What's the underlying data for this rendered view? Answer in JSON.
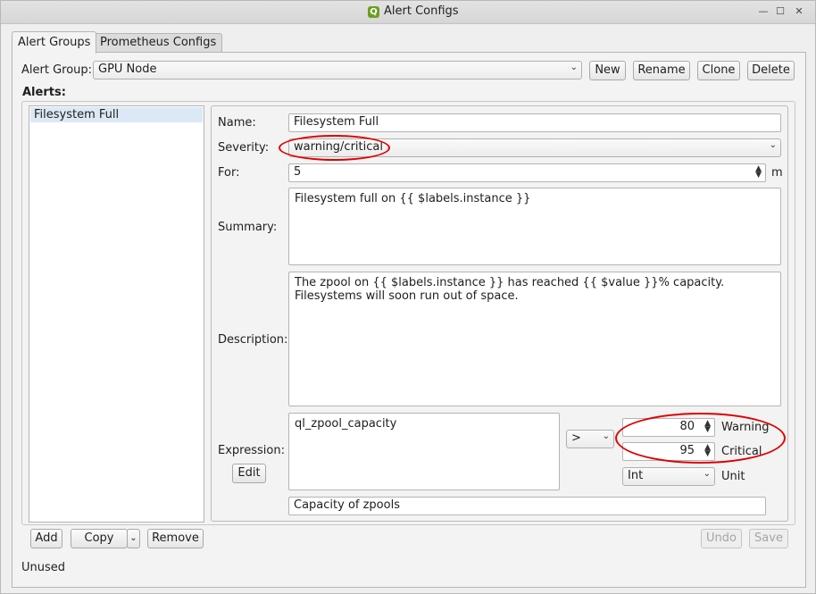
{
  "window": {
    "title": "Alert Configs",
    "app_icon": "Q"
  },
  "tabs": [
    {
      "label": "Alert Groups",
      "active": true
    },
    {
      "label": "Prometheus Configs",
      "active": false
    }
  ],
  "alert_group": {
    "label": "Alert Group:",
    "selected": "GPU Node",
    "buttons": {
      "new": "New",
      "rename": "Rename",
      "clone": "Clone",
      "delete": "Delete"
    }
  },
  "alerts_label": "Alerts:",
  "alerts_list": [
    "Filesystem Full"
  ],
  "list_buttons": {
    "add": "Add",
    "copy": "Copy",
    "remove": "Remove"
  },
  "form": {
    "name_label": "Name:",
    "name_value": "Filesystem Full",
    "severity_label": "Severity:",
    "severity_value": "warning/critical",
    "for_label": "For:",
    "for_value": "5",
    "for_unit": "m",
    "summary_label": "Summary:",
    "summary_value": "Filesystem full on {{ $labels.instance }}",
    "description_label": "Description:",
    "description_value": "The zpool on {{ $labels.instance }} has reached {{ $value }}% capacity. Filesystems will soon run out of space.",
    "expression_label": "Expression:",
    "expression_value": "ql_zpool_capacity",
    "edit_button": "Edit",
    "operator_value": ">",
    "warning_value": "80",
    "warning_label": "Warning",
    "critical_value": "95",
    "critical_label": "Critical",
    "unit_value": "Int",
    "unit_label": "Unit",
    "expression_description": "Capacity of zpools"
  },
  "action_buttons": {
    "undo": "Undo",
    "save": "Save"
  },
  "status": "Unused",
  "colors": {
    "highlight": "#e00000",
    "selection": "#dce8f5"
  }
}
